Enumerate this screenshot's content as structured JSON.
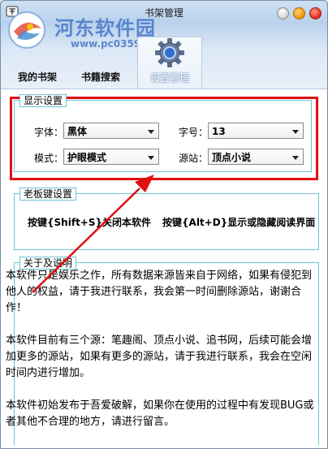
{
  "window": {
    "title": "书架管理",
    "watermark_text": "河东软件园",
    "watermark_url": "www.pc0359.cn"
  },
  "tabs": [
    {
      "label": "我的书架"
    },
    {
      "label": "书籍搜索"
    },
    {
      "label": "设置管理"
    }
  ],
  "display": {
    "legend": "显示设置",
    "font_label": "字体：",
    "font_value": "黑体",
    "size_label": "字号：",
    "size_value": "13",
    "mode_label": "模式：",
    "mode_value": "护眼模式",
    "source_label": "源站：",
    "source_value": "顶点小说"
  },
  "boss_key": {
    "legend": "老板键设置",
    "close_hint": "按键{Shift+S}关闭本软件",
    "toggle_hint": "按键{Alt+D}显示或隐藏阅读界面"
  },
  "about": {
    "legend": "关于及说明",
    "p1": "本软件只是娱乐之作，所有数据来源皆来自于网络，如果有侵犯到他人的权益，请于我进行联系，我会第一时间删除源站，谢谢合作！",
    "p2": "本软件目前有三个源：笔趣阁、顶点小说、追书网，后续可能会增加更多的源站，如果有更多的源站，请于我进行联系，我会在空闲时间内进行增加。",
    "p3": "本软件初始发布于吾爱破解，如果你在使用的过程中有发现BUG或者其他不合理的地方，请进行留言。"
  },
  "colors": {
    "highlight_border": "#e01010",
    "group_border": "#6fc3d6",
    "accent": "#4678c8"
  }
}
